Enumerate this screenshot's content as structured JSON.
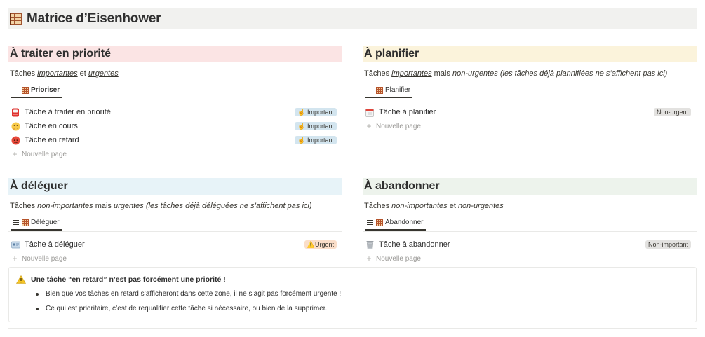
{
  "page": {
    "title": "Matrice d’Eisenhower",
    "icon": "abacus-icon"
  },
  "sections": {
    "priorite": {
      "heading": "À traiter en priorité",
      "heading_bg": "#fbe4e4",
      "desc_1": "Tâches ",
      "desc_2": "importantes",
      "desc_3": " et ",
      "desc_4": "urgentes",
      "tab": "Prioriser",
      "rows": [
        {
          "icon": "pager-icon",
          "name": "Tâche à traiter en priorité",
          "badge": "☝ Important"
        },
        {
          "icon": "thinking-face-icon",
          "name": "Tâche en cours",
          "badge": "☝ Important"
        },
        {
          "icon": "angry-face-icon",
          "name": "Tâche en retard",
          "badge": "☝ Important"
        }
      ],
      "new_page": "Nouvelle page"
    },
    "planifier": {
      "heading": "À planifier",
      "heading_bg": "#fbf3db",
      "desc_1": "Tâches ",
      "desc_2": "importantes",
      "desc_3": " mais ",
      "desc_4": "non-urgentes (les tâches déjà plannifiées ne s’affichent pas ici)",
      "tab": "Planifier",
      "rows": [
        {
          "icon": "calendar-icon",
          "name": "Tâche à planifier",
          "badge": "Non-urgent"
        }
      ],
      "new_page": "Nouvelle page"
    },
    "deleguer": {
      "heading": "À déléguer",
      "heading_bg": "#e7f3f8",
      "desc_1": "Tâches ",
      "desc_2": "non-importantes",
      "desc_3": " mais ",
      "desc_4": "urgentes",
      "desc_5": " (les tâches déjà déléguées ne s’affichent pas ici)",
      "tab": "Déléguer",
      "rows": [
        {
          "icon": "id-card-icon",
          "name": "Tâche à déléguer",
          "badge": "⚠️Urgent"
        }
      ],
      "new_page": "Nouvelle page"
    },
    "abandonner": {
      "heading": "À abandonner",
      "heading_bg": "#edf3ec",
      "desc_1": "Tâches ",
      "desc_2": "non-importantes",
      "desc_3": " et ",
      "desc_4": "non-urgentes",
      "tab": "Abandonner",
      "rows": [
        {
          "icon": "trash-can-icon",
          "name": "Tâche à abandonner",
          "badge": "Non-important"
        }
      ],
      "new_page": "Nouvelle page"
    }
  },
  "callout": {
    "icon": "warning-icon",
    "title": "Une tâche “en retard” n’est pas forcément une priorité !",
    "bullets": [
      "Bien que vos tâches en retard s’afficheront dans cette zone, il ne s’agit pas forcément urgente !",
      "Ce qui est prioritaire, c’est de requalifier cette tâche si nécessaire, ou bien de la supprimer."
    ]
  }
}
